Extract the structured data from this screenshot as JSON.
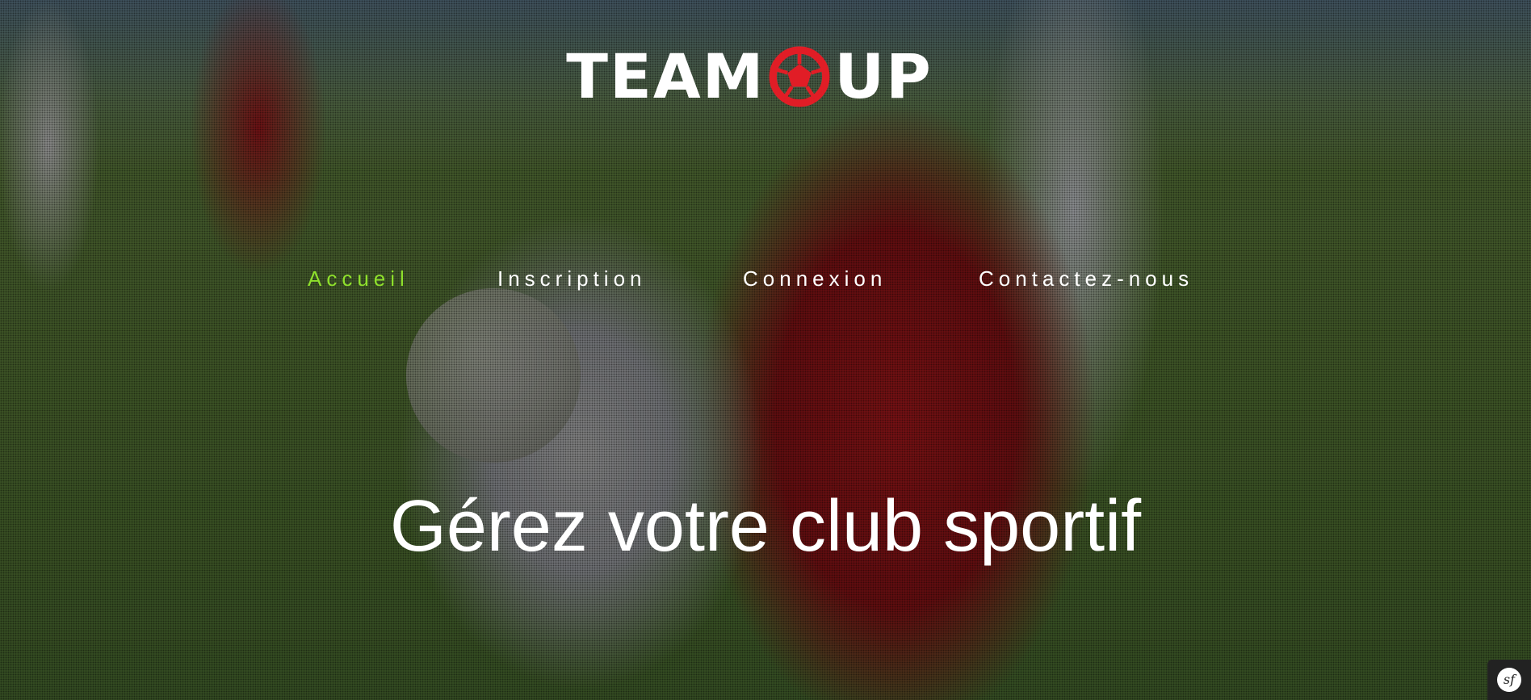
{
  "brand": {
    "logo_left": "TEAM",
    "logo_right": "UP",
    "logo_accent_color": "#e11d26"
  },
  "nav": {
    "items": [
      {
        "label": "Accueil",
        "active": true
      },
      {
        "label": "Inscription",
        "active": false
      },
      {
        "label": "Connexion",
        "active": false
      },
      {
        "label": "Contactez-nous",
        "active": false
      }
    ],
    "active_color": "#8ee02c"
  },
  "hero": {
    "headline": "Gérez votre club sportif"
  },
  "debug_toolbar": {
    "icon": "symfony-icon",
    "glyph": "sf"
  }
}
